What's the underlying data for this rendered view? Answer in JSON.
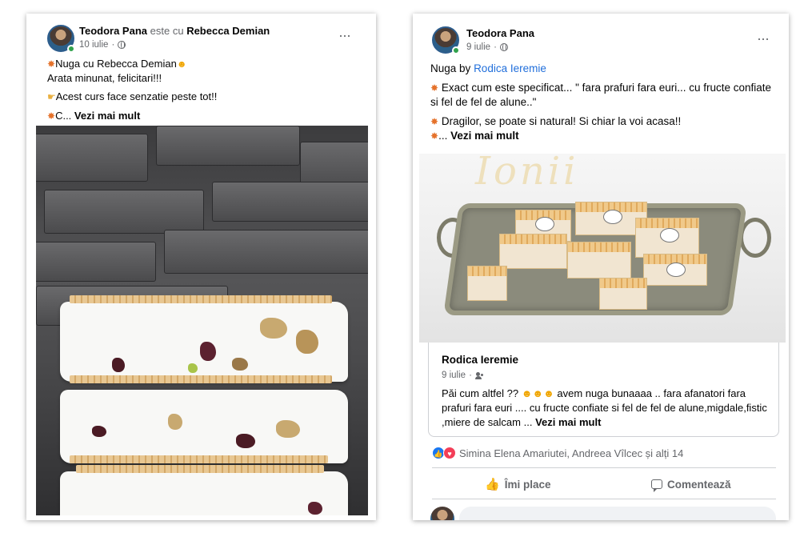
{
  "left_post": {
    "author": "Teodora Pana",
    "with_text": "este cu",
    "tagged": "Rebecca Demian",
    "date": "10 iulie",
    "date_sep": "·",
    "line1": "Nuga cu Rebecca Demian",
    "line2": "Arata minunat, felicitari!!!",
    "line3": "Acest curs face senzatie peste tot!!",
    "line4_prefix": "C...",
    "see_more": "Vezi mai mult",
    "more": "···",
    "icons": [
      "burst-icon",
      "heart-eyes-icon",
      "point-icon",
      "globe-icon"
    ]
  },
  "right_post": {
    "author": "Teodora Pana",
    "date": "9 iulie",
    "date_sep": "·",
    "intro_prefix": "Nuga by",
    "intro_tag": "Rodica Ieremie",
    "para1": "Exact cum este specificat... \" fara prafuri fara euri... cu fructe confiate si fel de fel de alune..\"",
    "para2": "Dragilor, se poate si natural! Si chiar la voi acasa!!",
    "para3_prefix": "...",
    "see_more": "Vezi mai mult",
    "more": "···",
    "watermark": "Ionii",
    "shared": {
      "author": "Rodica Ieremie",
      "date": "9 iulie",
      "date_sep": "·",
      "text_a": "Păi cum altfel ??",
      "text_b": "avem nuga bunaaaa .. fara afanatori fara prafuri fara euri .... cu fructe confiate si fel de fel de alune,migdale,fistic ,miere de salcam ...",
      "see_more": "Vezi mai mult"
    },
    "reactions_text": "Simina Elena Amariutei, Andreea Vîlcec și alți 14",
    "like_label": "Îmi place",
    "comment_label": "Comentează",
    "colors": {
      "link": "#216fdb",
      "like": "#1877f2",
      "love": "#f33e58",
      "muted": "#65676b"
    }
  }
}
